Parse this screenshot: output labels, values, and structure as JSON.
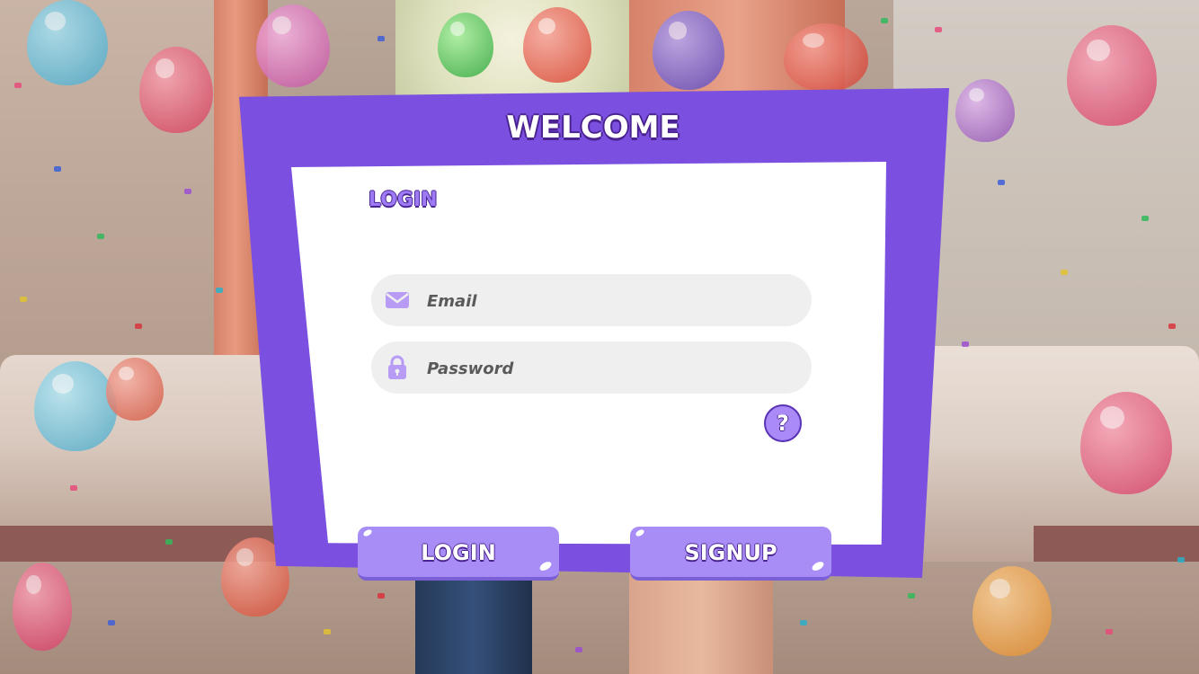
{
  "dialog": {
    "title": "WELCOME",
    "section_title": "LOGIN",
    "email": {
      "placeholder": "Email",
      "value": "",
      "icon": "envelope-icon"
    },
    "password": {
      "placeholder": "Password",
      "value": "",
      "icon": "lock-icon"
    },
    "help": {
      "label": "?",
      "icon": "question-icon"
    }
  },
  "buttons": {
    "login_label": "LOGIN",
    "signup_label": "SIGNUP"
  },
  "colors": {
    "frame_purple": "#7b4fdf",
    "button_lavender": "#a88df7",
    "icon_lavender": "#b79bf5",
    "field_gray": "#efefef",
    "outline_dark_purple": "#4a2391"
  }
}
